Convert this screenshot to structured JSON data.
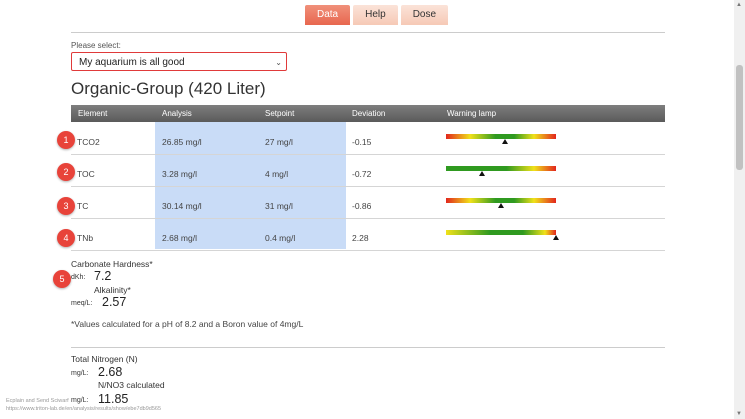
{
  "tabs": [
    {
      "label": "Data",
      "active": true
    },
    {
      "label": "Help",
      "active": false
    },
    {
      "label": "Dose",
      "active": false
    }
  ],
  "select": {
    "label": "Please select:",
    "value": "My aquarium is all good"
  },
  "group_title": "Organic-Group (420 Liter)",
  "table": {
    "headers": [
      "Element",
      "Analysis",
      "Setpoint",
      "Deviation",
      "Warning lamp"
    ],
    "rows": [
      {
        "badge": "1",
        "element": "TCO2",
        "analysis": "26.85 mg/l",
        "setpoint": "27 mg/l",
        "deviation": "-0.15",
        "lamp_position": 0.54
      },
      {
        "badge": "2",
        "element": "TOC",
        "analysis": "3.28 mg/l",
        "setpoint": "4 mg/l",
        "deviation": "-0.72",
        "lamp_position": 0.33
      },
      {
        "badge": "3",
        "element": "TC",
        "analysis": "30.14 mg/l",
        "setpoint": "31 mg/l",
        "deviation": "-0.86",
        "lamp_position": 0.5
      },
      {
        "badge": "4",
        "element": "TNb",
        "analysis": "2.68 mg/l",
        "setpoint": "0.4 mg/l",
        "deviation": "2.28",
        "lamp_position": 1.0
      }
    ]
  },
  "carbonate": {
    "badge": "5",
    "title": "Carbonate Hardness*",
    "dkh_unit": "dKh:",
    "dkh_value": "7.2",
    "alkalinity_label": "Alkalinity*",
    "meq_unit": "meq/L:",
    "meq_value": "2.57",
    "note": "*Values calculated for a pH of 8.2 and a Boron value of 4mg/L"
  },
  "nitrogen": {
    "title": "Total Nitrogen (N)",
    "mgl_unit": "mg/L:",
    "mgl_value": "2.68",
    "calc_label": "N/NO3 calculated",
    "mgl_unit2": "mg/L:",
    "mgl_value2": "11.85"
  },
  "footer": {
    "line1": "Ecplain and Send Sciwarf",
    "line2": "https://www.triton-lab.de/en/analysis/results/show/ebe7db9d565"
  }
}
